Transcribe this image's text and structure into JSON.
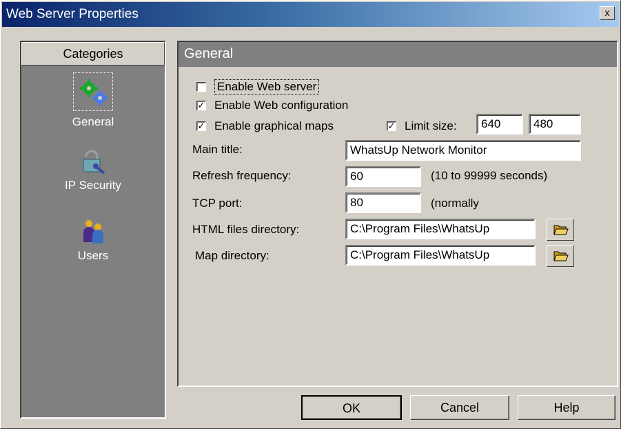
{
  "window": {
    "title": "Web Server Properties",
    "close_label": "x"
  },
  "sidebar": {
    "header": "Categories",
    "items": [
      {
        "label": "General",
        "icon": "gears-icon"
      },
      {
        "label": "IP Security",
        "icon": "lock-key-icon"
      },
      {
        "label": "Users",
        "icon": "users-icon"
      }
    ]
  },
  "panel": {
    "title": "General",
    "enable_web_server": {
      "label": "Enable Web server",
      "checked": false
    },
    "enable_web_config": {
      "label": "Enable Web configuration",
      "checked": true,
      "mark": "✓"
    },
    "enable_graphical_maps": {
      "label": "Enable graphical maps",
      "checked": true,
      "mark": "✓"
    },
    "limit_size": {
      "label": "Limit size:",
      "checked": true,
      "mark": "✓",
      "width": "640",
      "height": "480"
    },
    "main_title": {
      "label": "Main title:",
      "value": "WhatsUp Network Monitor"
    },
    "refresh": {
      "label": "Refresh frequency:",
      "value": "60",
      "hint": "(10 to 99999 seconds)"
    },
    "tcp_port": {
      "label": "TCP port:",
      "value": "80",
      "hint": "(normally"
    },
    "html_dir": {
      "label": "HTML files directory:",
      "value": "C:\\Program Files\\WhatsUp"
    },
    "map_dir": {
      "label": "Map directory:",
      "value": "C:\\Program Files\\WhatsUp"
    }
  },
  "buttons": {
    "ok": "OK",
    "cancel": "Cancel",
    "help": "Help"
  }
}
